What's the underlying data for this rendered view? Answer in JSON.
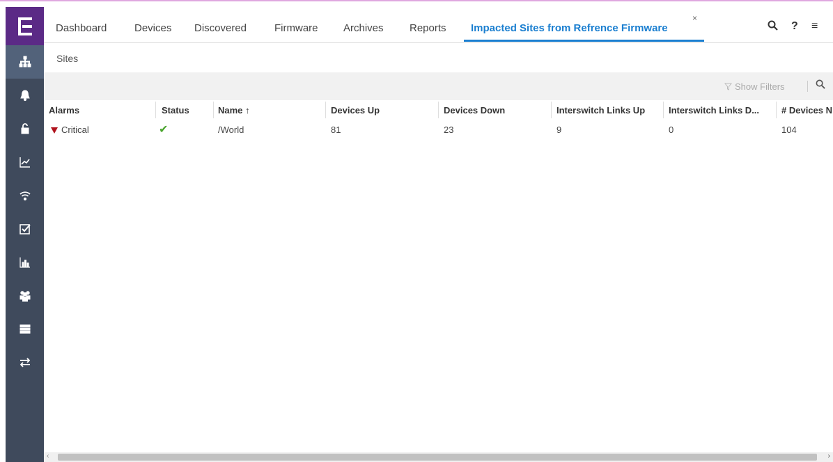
{
  "tabs": [
    {
      "label": "Dashboard"
    },
    {
      "label": "Devices"
    },
    {
      "label": "Discovered"
    },
    {
      "label": "Firmware"
    },
    {
      "label": "Archives"
    },
    {
      "label": "Reports"
    },
    {
      "label": "Impacted Sites from Refrence Firmware",
      "active": true
    }
  ],
  "tab_close": "×",
  "header_icons": {
    "search": "search-icon",
    "help": "?",
    "menu": "≡"
  },
  "breadcrumb": "Sites",
  "toolbar": {
    "show_filters": "Show Filters"
  },
  "table": {
    "columns": [
      "Alarms",
      "Status",
      "Name ↑",
      "Devices Up",
      "Devices Down",
      "Interswitch Links Up",
      "Interswitch Links D...",
      "# Devices N"
    ],
    "rows": [
      {
        "alarms": "Critical",
        "status": "✔",
        "name": "/World",
        "devices_up": "81",
        "devices_down": "23",
        "isl_up": "9",
        "isl_down": "0",
        "devices_n": "104"
      }
    ]
  },
  "sidebar": {
    "items": [
      "network-icon",
      "bell-icon",
      "lock-icon",
      "chart-icon",
      "wireless-icon",
      "checklist-icon",
      "bar-chart-icon",
      "users-icon",
      "server-icon",
      "transfer-icon"
    ]
  },
  "colors": {
    "accent": "#1b7fd0",
    "sidebar": "#3f4a5c",
    "logo": "#5b2a86",
    "critical": "#b0121c",
    "ok": "#4aa52e"
  }
}
